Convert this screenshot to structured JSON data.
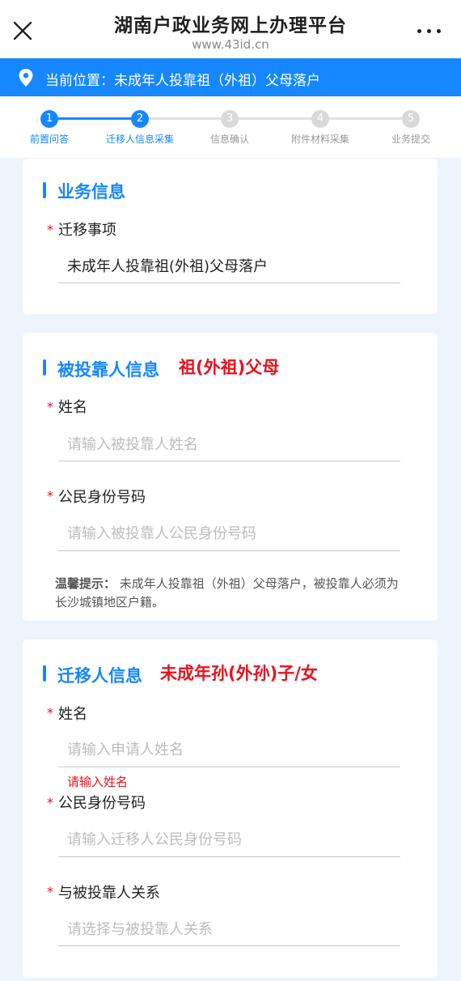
{
  "header": {
    "title": "湖南户政业务网上办理平台",
    "subtitle": "www.43id.cn"
  },
  "location": {
    "text": "当前位置：未成年人投靠祖（外祖）父母落户"
  },
  "steps": [
    {
      "num": "1",
      "label": "前置问答",
      "state": "done"
    },
    {
      "num": "2",
      "label": "迁移人信息采集",
      "state": "current"
    },
    {
      "num": "3",
      "label": "信息确认",
      "state": "todo"
    },
    {
      "num": "4",
      "label": "附件材料采集",
      "state": "todo"
    },
    {
      "num": "5",
      "label": "业务提交",
      "state": "todo"
    }
  ],
  "business": {
    "section_title": "业务信息",
    "field_label": "迁移事项",
    "field_value": "未成年人投靠祖(外祖)父母落户"
  },
  "relied": {
    "section_title": "被投靠人信息",
    "section_note": "祖(外祖)父母",
    "name_label": "姓名",
    "name_placeholder": "请输入被投靠人姓名",
    "id_label": "公民身份号码",
    "id_placeholder": "请输入被投靠人公民身份号码",
    "tip_prefix": "温馨提示：",
    "tip_text": "未成年人投靠祖（外祖）父母落户，被投靠人必须为长沙城镇地区户籍。"
  },
  "migrant": {
    "section_title": "迁移人信息",
    "section_note": "未成年孙(外孙)子/女",
    "name_label": "姓名",
    "name_placeholder": "请输入申请人姓名",
    "name_error": "请输入姓名",
    "id_label": "公民身份号码",
    "id_placeholder": "请输入迁移人公民身份号码",
    "relation_label": "与被投靠人关系",
    "relation_placeholder": "请选择与被投靠人关系"
  },
  "required_mark": "*",
  "colors": {
    "accent": "#1687ff",
    "error": "#e8121d"
  },
  "icons": {
    "close": "close-icon",
    "more": "more-icon",
    "location": "location-pin-icon"
  }
}
